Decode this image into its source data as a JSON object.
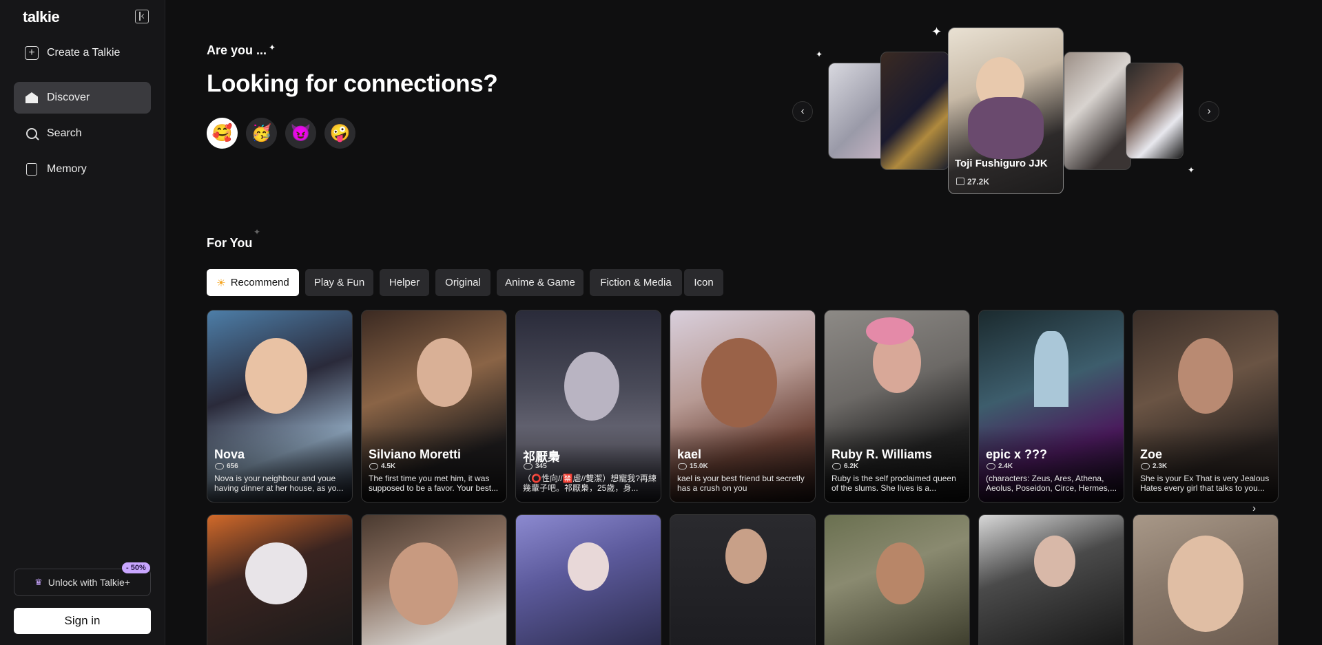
{
  "sidebar": {
    "logo": "talkie",
    "items": [
      {
        "label": "Create a Talkie",
        "icon": "plus-square-icon"
      },
      {
        "label": "Discover",
        "icon": "home-icon",
        "active": true
      },
      {
        "label": "Search",
        "icon": "search-icon"
      },
      {
        "label": "Memory",
        "icon": "memory-icon"
      }
    ],
    "unlock_label": "Unlock with Talkie+",
    "discount_badge": "- 50%",
    "signin_label": "Sign in"
  },
  "hero": {
    "subtitle": "Are you ...",
    "title": "Looking for connections?",
    "moods": [
      "🥰",
      "🥳",
      "😈",
      "🤪"
    ],
    "featured": {
      "name": "Toji Fushiguro JJK",
      "count": "27.2K"
    }
  },
  "for_you": {
    "heading": "For You",
    "tabs": [
      "Recommend",
      "Play & Fun",
      "Helper",
      "Original",
      "Anime & Game",
      "Fiction & Media",
      "Icon"
    ]
  },
  "cards": [
    {
      "name": "Nova",
      "count": "656",
      "desc": "Nova is your neighbour and youe having dinner at her house, as yo..."
    },
    {
      "name": "Silviano Moretti",
      "count": "4.5K",
      "desc": "The first time you met him, it was supposed to be a favor. Your best..."
    },
    {
      "name": "祁厭梟",
      "count": "345",
      "desc": "（⭕性向//🈲虐//雙潔）想寵我?再練幾輩子吧。祁厭梟，25歲，身..."
    },
    {
      "name": "kael",
      "count": "15.0K",
      "desc": "kael is your best friend but secretly has a crush on you"
    },
    {
      "name": "Ruby R. Williams",
      "count": "6.2K",
      "desc": "Ruby is the self proclaimed queen of the slums. She lives is a..."
    },
    {
      "name": "epic x ???",
      "count": "2.4K",
      "desc": "(characters: Zeus, Ares, Athena, Aeolus, Poseidon, Circe, Hermes,..."
    },
    {
      "name": "Zoe",
      "count": "2.3K",
      "desc": "She is your Ex That is very Jealous Hates every girl that talks to you..."
    }
  ]
}
